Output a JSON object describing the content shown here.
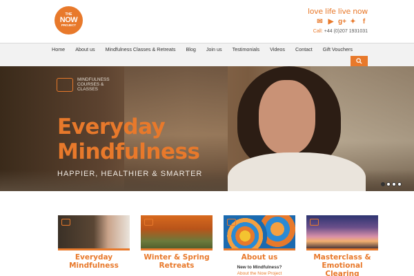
{
  "header": {
    "logo": {
      "line1": "THE",
      "line2": "NOW",
      "line3": "PROJECT"
    },
    "tagline": "love life live now",
    "social_icons": [
      "email-icon",
      "youtube-icon",
      "google-plus-icon",
      "twitter-icon",
      "facebook-icon"
    ],
    "phone_label": "Call:",
    "phone_number": "+44 (0)207 1931031"
  },
  "nav": {
    "items": [
      "Home",
      "About us",
      "Mindfulness Classes & Retreats",
      "Blog",
      "Join us",
      "Testimonials",
      "Videos",
      "Contact",
      "Gift Vouchers"
    ],
    "search_icon": "search-icon"
  },
  "hero": {
    "badge_text": "MINDFULNESS COURSES & CLASSES",
    "title_line1": "Everyday",
    "title_line2": "Mindfulness",
    "subtitle": "HAPPIER, HEALTHIER & SMARTER",
    "slides": 4,
    "active_slide": 1
  },
  "cards": [
    {
      "title_line1": "Everyday",
      "title_line2": "Mindfulness"
    },
    {
      "title_line1": "Winter & Spring",
      "title_line2": "Retreats"
    },
    {
      "title_line1": "About us",
      "title_line2": "",
      "sub": "New to Mindfulness?",
      "sub2": "About the Now Project"
    },
    {
      "title_line1": "Masterclass &",
      "title_line2": "Emotional Clearing"
    }
  ],
  "colors": {
    "accent": "#e8792b",
    "nav_bg": "#f2f2f2",
    "text": "#333333"
  }
}
